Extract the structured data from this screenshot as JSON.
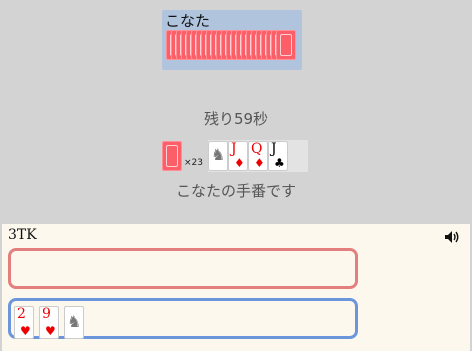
{
  "opponent": {
    "name": "こなた",
    "card_count": 23,
    "color": "#b0c4de"
  },
  "status": {
    "timer": "残り59秒",
    "turn": "こなたの手番です"
  },
  "deck": {
    "count_label": "×23"
  },
  "field": {
    "cards": [
      {
        "rank": "",
        "suit": "",
        "kind": "joker"
      },
      {
        "rank": "J",
        "suit": "♦",
        "color": "red"
      },
      {
        "rank": "Q",
        "suit": "♦",
        "color": "red"
      },
      {
        "rank": "J",
        "suit": "♣",
        "color": "black"
      }
    ]
  },
  "player": {
    "label": "3TK",
    "hand": [
      {
        "rank": "2",
        "suit": "♥",
        "color": "red"
      },
      {
        "rank": "9",
        "suit": "♥",
        "color": "red"
      },
      {
        "rank": "",
        "suit": "",
        "kind": "joker"
      }
    ]
  },
  "icons": {
    "sound": "speaker-icon",
    "joker": "joker-icon"
  },
  "colors": {
    "zone_top": "#e47f7f",
    "zone_bottom": "#6b96db",
    "card_back": "#fd5f68"
  }
}
